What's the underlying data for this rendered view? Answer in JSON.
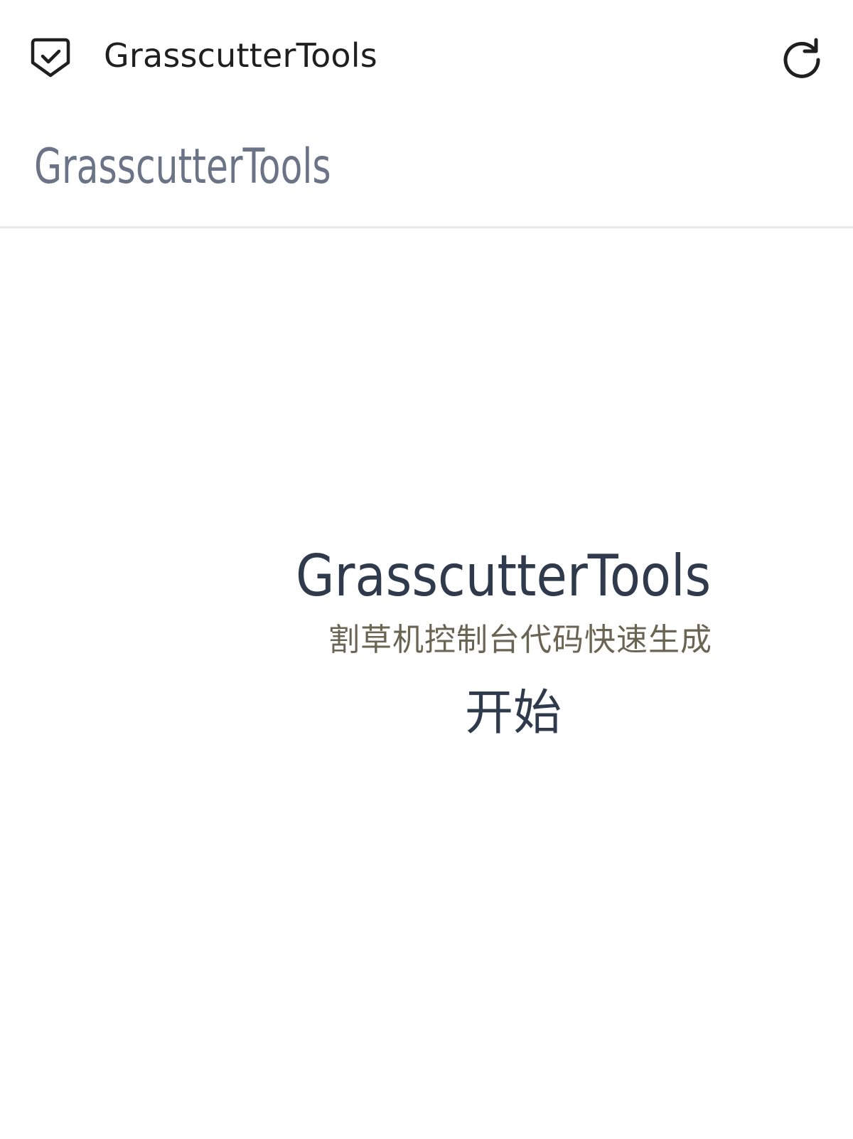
{
  "app_bar": {
    "title": "GrasscutterTools",
    "leading_icon": "shield-check-icon",
    "trailing_icon": "refresh-icon"
  },
  "page_header": {
    "title": "GrasscutterTools"
  },
  "hero": {
    "title": "GrasscutterTools",
    "subtitle": "割草机控制台代码快速生成",
    "start_label": "开始"
  },
  "colors": {
    "app_title": "#1f1f1f",
    "page_title": "#6b7387",
    "hero_title": "#2f3a4d",
    "hero_subtitle": "#6a6452",
    "divider": "#e6e8eb",
    "background": "#ffffff"
  }
}
